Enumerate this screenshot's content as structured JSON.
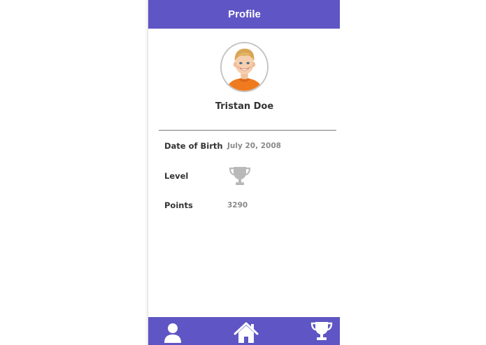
{
  "header": {
    "title": "Profile"
  },
  "profile": {
    "name": "Tristan Doe",
    "avatar_icon": "child-portrait-photo"
  },
  "details": [
    {
      "label": "Date of Birth",
      "value": "July 20, 2008"
    },
    {
      "label": "Level",
      "value_icon": "trophy-icon"
    },
    {
      "label": "Points",
      "value": "3290"
    }
  ],
  "bottom_nav": {
    "items": [
      {
        "icon": "user-icon"
      },
      {
        "icon": "home-icon"
      },
      {
        "icon": "trophy-icon"
      }
    ]
  },
  "colors": {
    "accent": "#5f55c4",
    "text_dark": "#333333",
    "text_muted": "#8a8a8a",
    "level_trophy": "#b9b9b9"
  }
}
